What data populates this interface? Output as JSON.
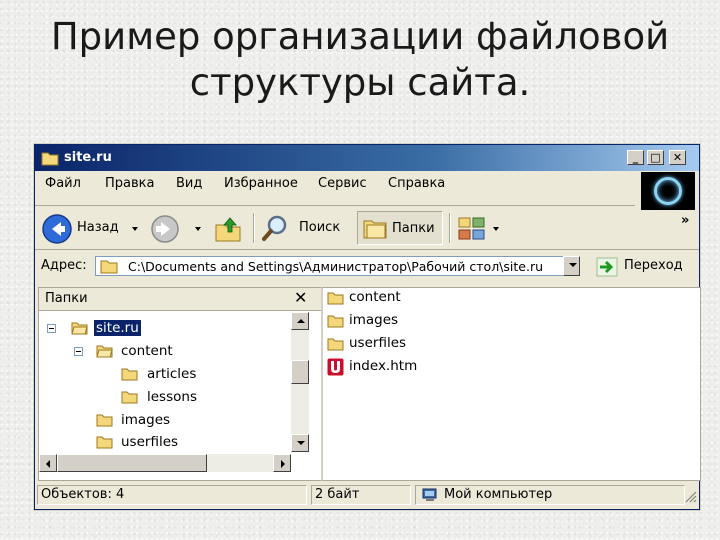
{
  "slide": {
    "title_line1": "Пример организации  файловой",
    "title_line2": "структуры сайта."
  },
  "window": {
    "title": "site.ru",
    "controls": [
      "minimize",
      "maximize",
      "close"
    ]
  },
  "menu": {
    "items": [
      "Файл",
      "Правка",
      "Вид",
      "Избранное",
      "Сервис",
      "Справка"
    ]
  },
  "toolbar": {
    "back_label": "Назад",
    "search_label": "Поиск",
    "folders_label": "Папки",
    "more_label": "»"
  },
  "address": {
    "label": "Адрес:",
    "value": "C:\\Documents and Settings\\Администратор\\Рабочий стол\\site.ru",
    "go_label": "Переход"
  },
  "folders_pane": {
    "title": "Папки",
    "tree": [
      {
        "label": "site.ru",
        "selected": true
      },
      {
        "label": "content"
      },
      {
        "label": "articles"
      },
      {
        "label": "lessons"
      },
      {
        "label": "images"
      },
      {
        "label": "userfiles"
      }
    ]
  },
  "files": [
    {
      "name": "content",
      "icon": "folder-icon"
    },
    {
      "name": "images",
      "icon": "folder-icon"
    },
    {
      "name": "userfiles",
      "icon": "folder-icon"
    },
    {
      "name": "index.htm",
      "icon": "ucoz-html-icon"
    }
  ],
  "status": {
    "objects": "Объектов: 4",
    "size": "2 байт",
    "location": "Мой компьютер"
  },
  "colors": {
    "titlebar_start": "#0a246a",
    "titlebar_end": "#a6caf0",
    "selection": "#0a246a",
    "folder": "#f4d77a",
    "window_bg": "#ece9d8"
  }
}
